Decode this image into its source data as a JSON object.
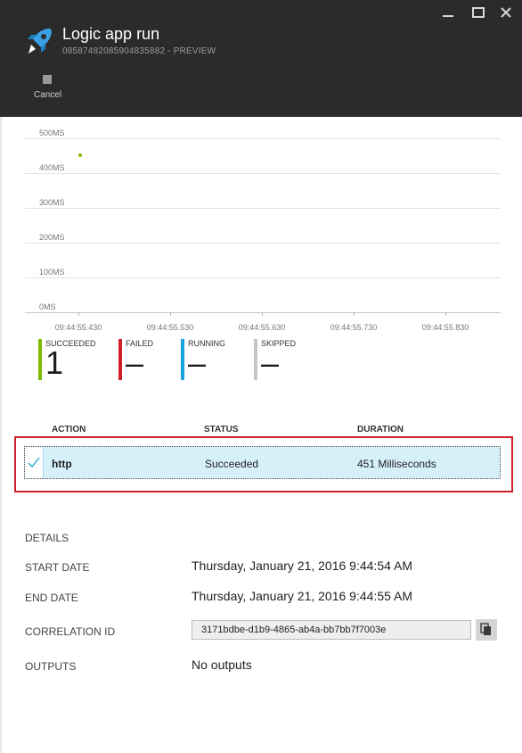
{
  "header": {
    "title": "Logic app run",
    "subtitle": "08587482085904835882 - PREVIEW",
    "cancel_label": "Cancel",
    "logo_icon": "rocket-icon"
  },
  "chart_data": {
    "type": "scatter",
    "y_ticks": [
      "500MS",
      "400MS",
      "300MS",
      "200MS",
      "100MS",
      "0MS"
    ],
    "x_ticks": [
      "09:44:55.430",
      "09:44:55.530",
      "09:44:55.630",
      "09:44:55.730",
      "09:44:55.830"
    ],
    "ylim": [
      0,
      500
    ],
    "series": [
      {
        "points": [
          {
            "x": "09:44:55.430",
            "y": 451
          }
        ],
        "color": "#7fba00"
      }
    ],
    "grid": true
  },
  "stats": [
    {
      "label": "SUCCEEDED",
      "value": "1",
      "color": "#7fba00"
    },
    {
      "label": "FAILED",
      "value": "–",
      "color": "#d11f2a"
    },
    {
      "label": "RUNNING",
      "value": "–",
      "color": "#1ba1e2"
    },
    {
      "label": "SKIPPED",
      "value": "–",
      "color": "#c6c6c6"
    }
  ],
  "table": {
    "headers": {
      "action": "ACTION",
      "status": "STATUS",
      "duration": "DURATION"
    },
    "rows": [
      {
        "action": "http",
        "status": "Succeeded",
        "duration": "451 Milliseconds"
      }
    ]
  },
  "details": {
    "heading": "DETAILS",
    "start_label": "START DATE",
    "start_value": "Thursday, January 21, 2016 9:44:54 AM",
    "end_label": "END DATE",
    "end_value": "Thursday, January 21, 2016 9:44:55 AM",
    "correlation_label": "CORRELATION ID",
    "correlation_value": "3171bdbe-d1b9-4865-ab4a-bb7bb7f7003e",
    "outputs_label": "OUTPUTS",
    "outputs_value": "No outputs"
  },
  "colors": {
    "header_bg": "#2b2b2b",
    "highlight": "#d11f2a",
    "row_selected": "#d6f0fa"
  }
}
